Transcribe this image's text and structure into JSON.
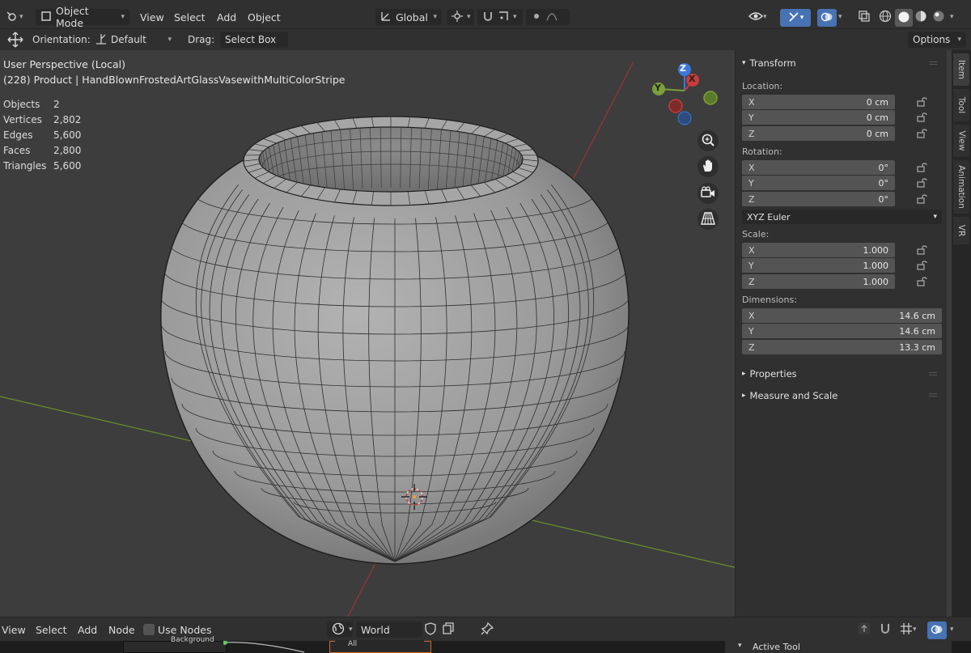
{
  "header": {
    "mode_label": "Object Mode",
    "menus": [
      "View",
      "Select",
      "Add",
      "Object"
    ],
    "transform_orientation": "Global",
    "options_label": "Options"
  },
  "tool_header": {
    "orientation_label": "Orientation:",
    "orientation_value": "Default",
    "drag_label": "Drag:",
    "drag_value": "Select Box"
  },
  "viewport": {
    "view_name": "User Perspective (Local)",
    "object_info": "(228) Product | HandBlownFrostedArtGlassVasewithMultiColorStripe",
    "stats": [
      {
        "label": "Objects",
        "value": "2"
      },
      {
        "label": "Vertices",
        "value": "2,802"
      },
      {
        "label": "Edges",
        "value": "5,600"
      },
      {
        "label": "Faces",
        "value": "2,800"
      },
      {
        "label": "Triangles",
        "value": "5,600"
      }
    ],
    "gizmo_axes": {
      "z": "Z",
      "y": "Y",
      "x": "X"
    }
  },
  "npanel": {
    "transform_title": "Transform",
    "location_label": "Location:",
    "location": [
      {
        "axis": "X",
        "value": "0 cm"
      },
      {
        "axis": "Y",
        "value": "0 cm"
      },
      {
        "axis": "Z",
        "value": "0 cm"
      }
    ],
    "rotation_label": "Rotation:",
    "rotation": [
      {
        "axis": "X",
        "value": "0°"
      },
      {
        "axis": "Y",
        "value": "0°"
      },
      {
        "axis": "Z",
        "value": "0°"
      }
    ],
    "rotation_mode": "XYZ Euler",
    "scale_label": "Scale:",
    "scale": [
      {
        "axis": "X",
        "value": "1.000"
      },
      {
        "axis": "Y",
        "value": "1.000"
      },
      {
        "axis": "Z",
        "value": "1.000"
      }
    ],
    "dimensions_label": "Dimensions:",
    "dimensions": [
      {
        "axis": "X",
        "value": "14.6 cm"
      },
      {
        "axis": "Y",
        "value": "14.6 cm"
      },
      {
        "axis": "Z",
        "value": "13.3 cm"
      }
    ],
    "properties_title": "Properties",
    "measure_title": "Measure and Scale"
  },
  "sidebar_tabs": [
    "Item",
    "Tool",
    "View",
    "Animation",
    "VR"
  ],
  "node_editor": {
    "menus": [
      "View",
      "Select",
      "Add",
      "Node"
    ],
    "use_nodes_label": "Use Nodes",
    "world_name": "World",
    "bg_node_label": "Background",
    "all_label": "All",
    "active_tool_label": "Active Tool"
  },
  "colors": {
    "axis_x": "#c83c3c",
    "axis_y": "#7aa03a",
    "axis_z": "#3c78d8",
    "accent": "#4772b3"
  }
}
